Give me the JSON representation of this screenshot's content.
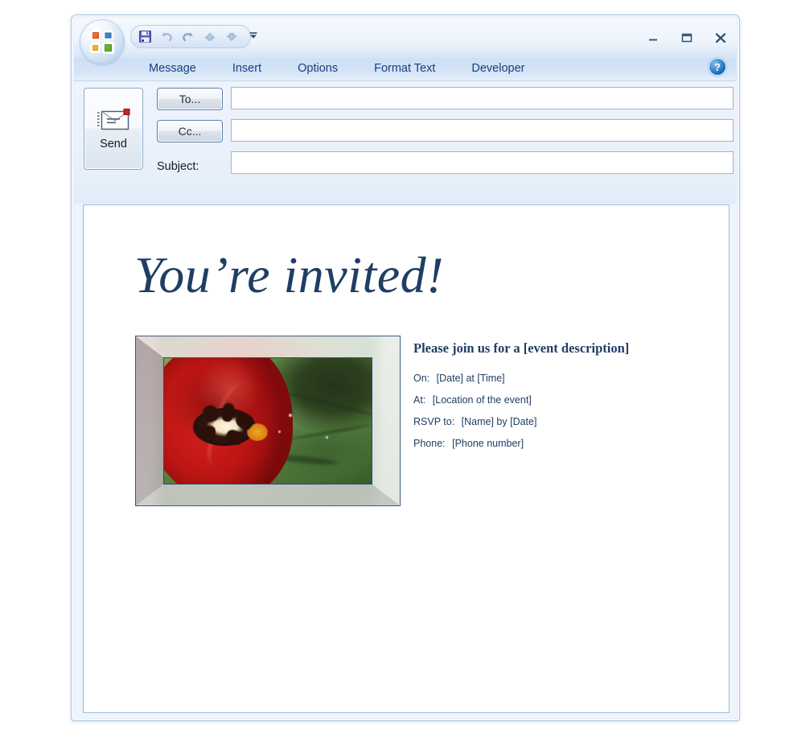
{
  "window": {
    "office_button": "office-orb",
    "quick_access": [
      {
        "name": "save",
        "icon": "save-icon",
        "label": "Save"
      },
      {
        "name": "undo",
        "icon": "undo-icon",
        "label": "Undo"
      },
      {
        "name": "redo",
        "icon": "redo-icon",
        "label": "Redo"
      },
      {
        "name": "previous-item",
        "icon": "previous-item-icon",
        "label": "Previous Item"
      },
      {
        "name": "next-item",
        "icon": "next-item-icon",
        "label": "Next Item"
      }
    ],
    "qat_customize_label": "Customize Quick Access Toolbar",
    "controls": {
      "minimize": "–",
      "maximize": "❐",
      "close": "✕"
    }
  },
  "ribbon": {
    "tabs": [
      {
        "label": "Message",
        "active": true
      },
      {
        "label": "Insert",
        "active": false
      },
      {
        "label": "Options",
        "active": false
      },
      {
        "label": "Format Text",
        "active": false
      },
      {
        "label": "Developer",
        "active": false
      }
    ],
    "help_label": "?"
  },
  "compose": {
    "send_label": "Send",
    "to_label": "To...",
    "cc_label": "Cc...",
    "subject_label": "Subject:",
    "to_value": "",
    "cc_value": "",
    "subject_value": "",
    "to_placeholder": "",
    "cc_placeholder": "",
    "subject_placeholder": ""
  },
  "message": {
    "title": "You’re invited!",
    "image_alt": "red tulip flower in beveled glass frame",
    "heading": "Please join us for a [event description]",
    "details": [
      {
        "label": "On:",
        "value": "[Date] at [Time]"
      },
      {
        "label": "At:",
        "value": "[Location of the event]"
      },
      {
        "label": "RSVP to:",
        "value": "[Name] by [Date]"
      },
      {
        "label": "Phone:",
        "value": "[Phone number]"
      }
    ]
  },
  "colors": {
    "accent_navy": "#1f3e63",
    "window_border": "#a6c2e4",
    "tab_text": "#16407a",
    "field_bg": "#ffffff",
    "header_bg": "#e9f1fb"
  }
}
